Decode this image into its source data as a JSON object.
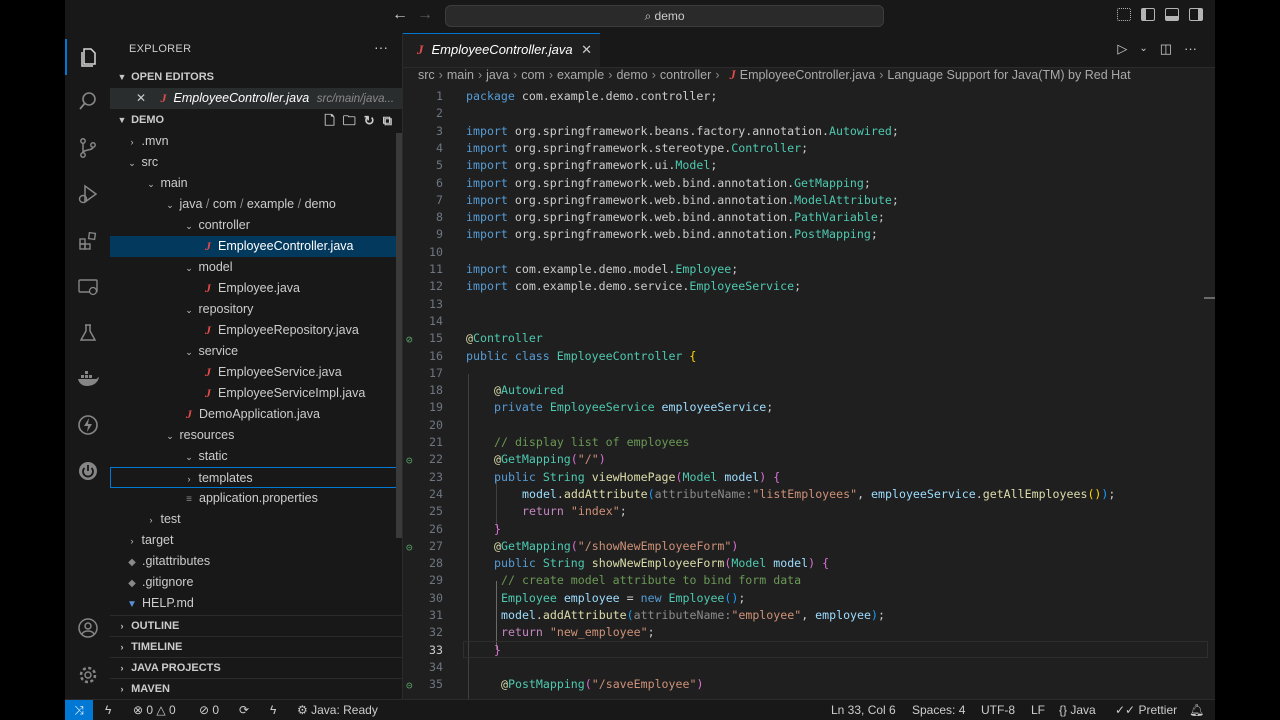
{
  "search": {
    "text": "demo"
  },
  "activity": {
    "explorer": "files-icon",
    "search": "search-icon",
    "scm": "source-control-icon",
    "debug": "run-debug-icon",
    "extensions": "extensions-icon",
    "remote": "remote-explorer-icon",
    "testing": "testing-icon",
    "docker": "docker-icon",
    "spring": "spring-boot-icon",
    "power": "power-icon",
    "account": "account-icon",
    "manage": "gear-icon"
  },
  "sidebar": {
    "title": "EXPLORER",
    "more": "···",
    "open_editors": {
      "label": "OPEN EDITORS",
      "file": "EmployeeController.java",
      "path": "src/main/java..."
    },
    "folder": "DEMO",
    "tree": {
      "mvn": ".mvn",
      "src": "src",
      "main": "main",
      "java": "java",
      "com": "com",
      "example": "example",
      "demo": "demo",
      "controller": "controller",
      "employee_controller": "EmployeeController.java",
      "model": "model",
      "employee": "Employee.java",
      "repository": "repository",
      "employee_repository": "EmployeeRepository.java",
      "service": "service",
      "employee_service": "EmployeeService.java",
      "employee_service_impl": "EmployeeServiceImpl.java",
      "demo_application": "DemoApplication.java",
      "resources": "resources",
      "static": "static",
      "templates": "templates",
      "app_properties": "application.properties",
      "test": "test",
      "target": "target",
      "gitattributes": ".gitattributes",
      "gitignore": ".gitignore",
      "help": "HELP.md"
    },
    "sections": {
      "outline": "OUTLINE",
      "timeline": "TIMELINE",
      "java_projects": "JAVA PROJECTS",
      "maven": "MAVEN"
    }
  },
  "editor": {
    "tab": "EmployeeController.java",
    "breadcrumb": [
      "src",
      "main",
      "java",
      "com",
      "example",
      "demo",
      "controller"
    ],
    "breadcrumb_file": "EmployeeController.java",
    "breadcrumb_extra": "Language Support for Java(TM) by Red Hat",
    "line_numbers": [
      "1",
      "2",
      "3",
      "4",
      "5",
      "6",
      "7",
      "8",
      "9",
      "10",
      "11",
      "12",
      "13",
      "14",
      "15",
      "16",
      "17",
      "18",
      "19",
      "20",
      "21",
      "22",
      "23",
      "24",
      "25",
      "26",
      "27",
      "28",
      "29",
      "30",
      "31",
      "32",
      "33",
      "34",
      "35"
    ],
    "code": {
      "l1_kw": "package",
      "l1_pkg": " com.example.demo.controller;",
      "import": "import",
      "l3": " org.springframework.beans.factory.annotation.",
      "l3_t": "Autowired",
      "l4": " org.springframework.stereotype.",
      "l4_t": "Controller",
      "l5": " org.springframework.ui.",
      "l5_t": "Model",
      "l6": " org.springframework.web.bind.annotation.",
      "l6_t": "GetMapping",
      "l7": " org.springframework.web.bind.annotation.",
      "l7_t": "ModelAttribute",
      "l8": " org.springframework.web.bind.annotation.",
      "l8_t": "PathVariable",
      "l9": " org.springframework.web.bind.annotation.",
      "l9_t": "PostMapping",
      "l11": " com.example.demo.model.",
      "l11_t": "Employee",
      "l12": " com.example.demo.service.",
      "l12_t": "EmployeeService",
      "l15_at": "@",
      "l15_an": "Controller",
      "l16_pub": "public",
      "l16_cls": " class ",
      "l16_name": "EmployeeController",
      "l16_br": " {",
      "l18_at": "@",
      "l18_an": "Autowired",
      "l19_priv": "private",
      "l19_ty": " EmployeeService",
      "l19_var": " employeeService",
      "l19_end": ";",
      "l21": "// display list of employees",
      "l22_at": "@",
      "l22_an": "GetMapping",
      "l22_p1": "(",
      "l22_str": "\"/\"",
      "l22_p2": ")",
      "l23_pub": "public",
      "l23_ty": " String",
      "l23_fn": " viewHomePage",
      "l23_p1": "(",
      "l23_pt": "Model",
      "l23_pv": " model",
      "l23_p2": ")",
      "l23_br": " {",
      "l24_var": "model",
      "l24_dot": ".",
      "l24_fn": "addAttribute",
      "l24_p1": "(",
      "l24_hint": "attributeName:",
      "l24_str": "\"listEmployees\"",
      "l24_c": ", ",
      "l24_var2": "employeeService",
      "l24_dot2": ".",
      "l24_fn2": "getAllEmployees",
      "l24_p2": "()",
      "l24_p3": ")",
      "l24_end": ";",
      "l25_ret": "return",
      "l25_str": " \"index\"",
      "l25_end": ";",
      "l26": "}",
      "l27_at": "@",
      "l27_an": "GetMapping",
      "l27_p1": "(",
      "l27_str": "\"/showNewEmployeeForm\"",
      "l27_p2": ")",
      "l28_pub": "public",
      "l28_ty": " String",
      "l28_fn": " showNewEmployeeForm",
      "l28_p1": "(",
      "l28_pt": "Model",
      "l28_pv": " model",
      "l28_p2": ")",
      "l28_br": " {",
      "l29": "// create model attribute to bind form data",
      "l30_ty": "Employee",
      "l30_var": " employee",
      "l30_eq": " = ",
      "l30_new": "new",
      "l30_ty2": " Employee",
      "l30_p": "()",
      "l30_end": ";",
      "l31_var": "model",
      "l31_dot": ".",
      "l31_fn": "addAttribute",
      "l31_p1": "(",
      "l31_hint": "attributeName:",
      "l31_str": "\"employee\"",
      "l31_c": ", ",
      "l31_var2": "employee",
      "l31_p2": ")",
      "l31_end": ";",
      "l32_ret": "return",
      "l32_str": " \"new_employee\"",
      "l32_end": ";",
      "l33": "}",
      "l35_at": "@",
      "l35_an": "PostMapping",
      "l35_p1": "(",
      "l35_str": "\"/saveEmployee\"",
      "l35_p2": ")"
    }
  },
  "statusbar": {
    "errors": "0",
    "warnings": "0",
    "ports": "0",
    "java_status": "Java: Ready",
    "position": "Ln 33, Col 6",
    "spaces": "Spaces: 4",
    "encoding": "UTF-8",
    "eol": "LF",
    "language_brace": "{}",
    "language": "Java",
    "formatter": "Prettier"
  },
  "colors": {
    "accent": "#0078d4",
    "selection": "#04395e",
    "java_icon": "#e34b4b"
  }
}
